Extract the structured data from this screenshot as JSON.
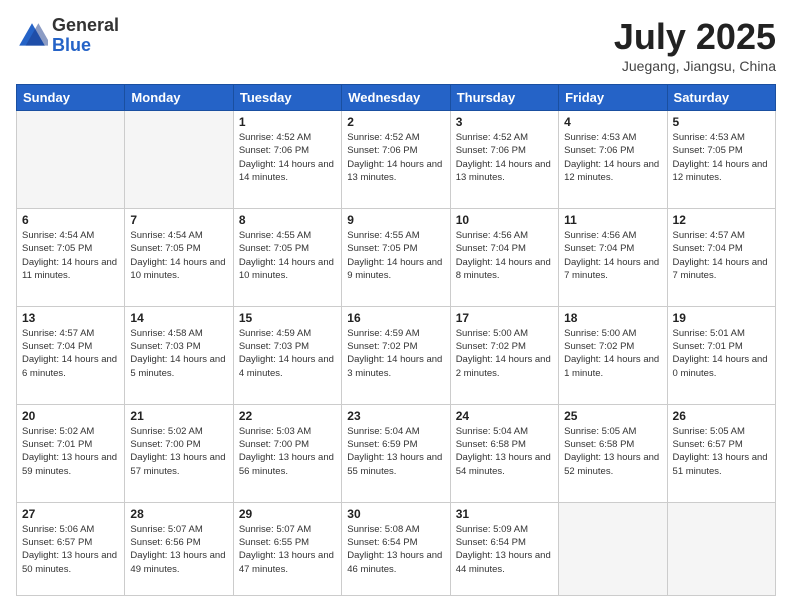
{
  "header": {
    "logo_general": "General",
    "logo_blue": "Blue",
    "month_title": "July 2025",
    "location": "Juegang, Jiangsu, China"
  },
  "weekdays": [
    "Sunday",
    "Monday",
    "Tuesday",
    "Wednesday",
    "Thursday",
    "Friday",
    "Saturday"
  ],
  "weeks": [
    [
      {
        "day": "",
        "empty": true
      },
      {
        "day": "",
        "empty": true
      },
      {
        "day": "1",
        "sunrise": "4:52 AM",
        "sunset": "7:06 PM",
        "daylight": "14 hours and 14 minutes."
      },
      {
        "day": "2",
        "sunrise": "4:52 AM",
        "sunset": "7:06 PM",
        "daylight": "14 hours and 13 minutes."
      },
      {
        "day": "3",
        "sunrise": "4:52 AM",
        "sunset": "7:06 PM",
        "daylight": "14 hours and 13 minutes."
      },
      {
        "day": "4",
        "sunrise": "4:53 AM",
        "sunset": "7:06 PM",
        "daylight": "14 hours and 12 minutes."
      },
      {
        "day": "5",
        "sunrise": "4:53 AM",
        "sunset": "7:05 PM",
        "daylight": "14 hours and 12 minutes."
      }
    ],
    [
      {
        "day": "6",
        "sunrise": "4:54 AM",
        "sunset": "7:05 PM",
        "daylight": "14 hours and 11 minutes."
      },
      {
        "day": "7",
        "sunrise": "4:54 AM",
        "sunset": "7:05 PM",
        "daylight": "14 hours and 10 minutes."
      },
      {
        "day": "8",
        "sunrise": "4:55 AM",
        "sunset": "7:05 PM",
        "daylight": "14 hours and 10 minutes."
      },
      {
        "day": "9",
        "sunrise": "4:55 AM",
        "sunset": "7:05 PM",
        "daylight": "14 hours and 9 minutes."
      },
      {
        "day": "10",
        "sunrise": "4:56 AM",
        "sunset": "7:04 PM",
        "daylight": "14 hours and 8 minutes."
      },
      {
        "day": "11",
        "sunrise": "4:56 AM",
        "sunset": "7:04 PM",
        "daylight": "14 hours and 7 minutes."
      },
      {
        "day": "12",
        "sunrise": "4:57 AM",
        "sunset": "7:04 PM",
        "daylight": "14 hours and 7 minutes."
      }
    ],
    [
      {
        "day": "13",
        "sunrise": "4:57 AM",
        "sunset": "7:04 PM",
        "daylight": "14 hours and 6 minutes."
      },
      {
        "day": "14",
        "sunrise": "4:58 AM",
        "sunset": "7:03 PM",
        "daylight": "14 hours and 5 minutes."
      },
      {
        "day": "15",
        "sunrise": "4:59 AM",
        "sunset": "7:03 PM",
        "daylight": "14 hours and 4 minutes."
      },
      {
        "day": "16",
        "sunrise": "4:59 AM",
        "sunset": "7:02 PM",
        "daylight": "14 hours and 3 minutes."
      },
      {
        "day": "17",
        "sunrise": "5:00 AM",
        "sunset": "7:02 PM",
        "daylight": "14 hours and 2 minutes."
      },
      {
        "day": "18",
        "sunrise": "5:00 AM",
        "sunset": "7:02 PM",
        "daylight": "14 hours and 1 minute."
      },
      {
        "day": "19",
        "sunrise": "5:01 AM",
        "sunset": "7:01 PM",
        "daylight": "14 hours and 0 minutes."
      }
    ],
    [
      {
        "day": "20",
        "sunrise": "5:02 AM",
        "sunset": "7:01 PM",
        "daylight": "13 hours and 59 minutes."
      },
      {
        "day": "21",
        "sunrise": "5:02 AM",
        "sunset": "7:00 PM",
        "daylight": "13 hours and 57 minutes."
      },
      {
        "day": "22",
        "sunrise": "5:03 AM",
        "sunset": "7:00 PM",
        "daylight": "13 hours and 56 minutes."
      },
      {
        "day": "23",
        "sunrise": "5:04 AM",
        "sunset": "6:59 PM",
        "daylight": "13 hours and 55 minutes."
      },
      {
        "day": "24",
        "sunrise": "5:04 AM",
        "sunset": "6:58 PM",
        "daylight": "13 hours and 54 minutes."
      },
      {
        "day": "25",
        "sunrise": "5:05 AM",
        "sunset": "6:58 PM",
        "daylight": "13 hours and 52 minutes."
      },
      {
        "day": "26",
        "sunrise": "5:05 AM",
        "sunset": "6:57 PM",
        "daylight": "13 hours and 51 minutes."
      }
    ],
    [
      {
        "day": "27",
        "sunrise": "5:06 AM",
        "sunset": "6:57 PM",
        "daylight": "13 hours and 50 minutes."
      },
      {
        "day": "28",
        "sunrise": "5:07 AM",
        "sunset": "6:56 PM",
        "daylight": "13 hours and 49 minutes."
      },
      {
        "day": "29",
        "sunrise": "5:07 AM",
        "sunset": "6:55 PM",
        "daylight": "13 hours and 47 minutes."
      },
      {
        "day": "30",
        "sunrise": "5:08 AM",
        "sunset": "6:54 PM",
        "daylight": "13 hours and 46 minutes."
      },
      {
        "day": "31",
        "sunrise": "5:09 AM",
        "sunset": "6:54 PM",
        "daylight": "13 hours and 44 minutes."
      },
      {
        "day": "",
        "empty": true
      },
      {
        "day": "",
        "empty": true
      }
    ]
  ]
}
